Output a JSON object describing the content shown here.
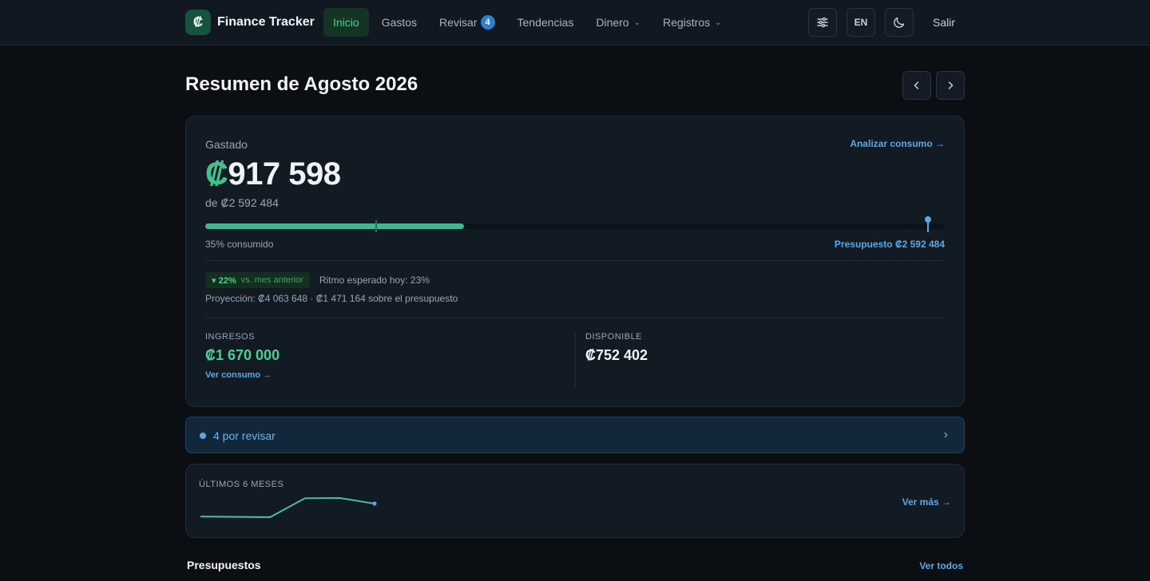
{
  "header": {
    "logo_glyph": "₡",
    "app_name": "Finance Tracker",
    "nav": [
      {
        "label": "Inicio",
        "active": true
      },
      {
        "label": "Gastos"
      },
      {
        "label": "Revisar",
        "badge": "4"
      },
      {
        "label": "Tendencias"
      },
      {
        "label": "Dinero",
        "dropdown": true
      },
      {
        "label": "Registros",
        "dropdown": true
      }
    ],
    "lang_label": "EN",
    "logout_label": "Salir",
    "icons": {
      "settings": "sliders-icon",
      "theme": "moon-icon"
    }
  },
  "page": {
    "title": "Resumen de Agosto 2026"
  },
  "summary": {
    "spent_label": "Gastado",
    "analyze_link": "Analizar consumo →",
    "spent_currency": "₡",
    "spent_value": "917 598",
    "of_text": "de ₡2 592 484",
    "progress_fraction": 0.35,
    "expected_pace_fraction": 0.23,
    "consumed_text": "35% consumido",
    "budget_text": "Presupuesto ₡2 592 484",
    "change_pct": "▾ 22%",
    "change_vs": "vs. mes anterior",
    "pace_text": "Ritmo esperado hoy: 23%",
    "projection_text": "Proyección: ₡4 063 648 · ₡1 471 164 sobre el presupuesto",
    "income_label": "INGRESOS",
    "income_value": "₡1 670 000",
    "income_link": "Ver consumo →",
    "available_label": "DISPONIBLE",
    "available_value": "₡752 402"
  },
  "review": {
    "text": "4 por revisar",
    "arrow": "›"
  },
  "trend": {
    "label": "ÚLTIMOS 6 MESES",
    "link": "Ver más →",
    "values": [
      0.82,
      0.8,
      0.78,
      1.95,
      1.97,
      1.62
    ],
    "color": "#4ac0a0"
  },
  "budgets": {
    "title": "Presupuestos",
    "link": "Ver todos"
  },
  "colors": {
    "accent_green": "#4fce91",
    "accent_blue": "#5aa9e6",
    "background": "#0b0f14"
  }
}
